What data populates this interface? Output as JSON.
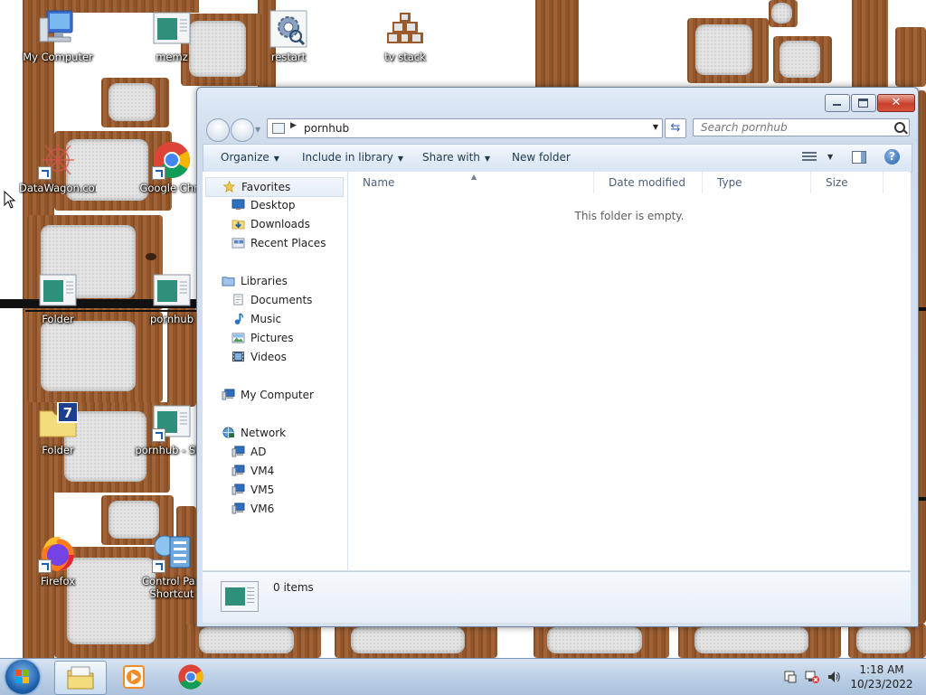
{
  "desktop": {
    "icons": [
      {
        "label": "My Computer",
        "icon": "my-computer-icon"
      },
      {
        "label": "memz",
        "icon": "window-icon"
      },
      {
        "label": "restart",
        "icon": "gear-icon"
      },
      {
        "label": "tv stack",
        "icon": "tv-stack-icon"
      },
      {
        "label": "DataWagon.com",
        "icon": "internet-shortcut-icon"
      },
      {
        "label": "Google Chro",
        "icon": "chrome-icon"
      },
      {
        "label": "Folder",
        "icon": "window-icon"
      },
      {
        "label": "pornhub",
        "icon": "window-icon"
      },
      {
        "label": "Folder",
        "icon": "folder-7-icon"
      },
      {
        "label": "pornhub - Sho",
        "icon": "window-icon"
      },
      {
        "label": "Firefox",
        "icon": "firefox-icon"
      },
      {
        "label": "Control Pan",
        "label2": "Shortcut",
        "icon": "control-panel-icon"
      }
    ]
  },
  "window": {
    "address_path": "pornhub",
    "search_placeholder": "Search pornhub",
    "close_glyph": "✕",
    "toolbar": {
      "organize": "Organize",
      "include_in_library": "Include in library",
      "share_with": "Share with",
      "new_folder": "New folder"
    },
    "nav": {
      "favorites": "Favorites",
      "desktop": "Desktop",
      "downloads": "Downloads",
      "recent_places": "Recent Places",
      "libraries": "Libraries",
      "documents": "Documents",
      "music": "Music",
      "pictures": "Pictures",
      "videos": "Videos",
      "my_computer": "My Computer",
      "network": "Network",
      "ad": "AD",
      "vm4": "VM4",
      "vm5": "VM5",
      "vm6": "VM6"
    },
    "columns": {
      "name": "Name",
      "date_modified": "Date modified",
      "type": "Type",
      "size": "Size"
    },
    "empty_message": "This folder is empty.",
    "item_count": "0 items"
  },
  "taskbar": {
    "time": "1:18 AM",
    "date": "10/23/2022"
  },
  "colors": {
    "accent": "#1b5ea8",
    "wood": "#9a5a2c",
    "close": "#c7402c"
  }
}
